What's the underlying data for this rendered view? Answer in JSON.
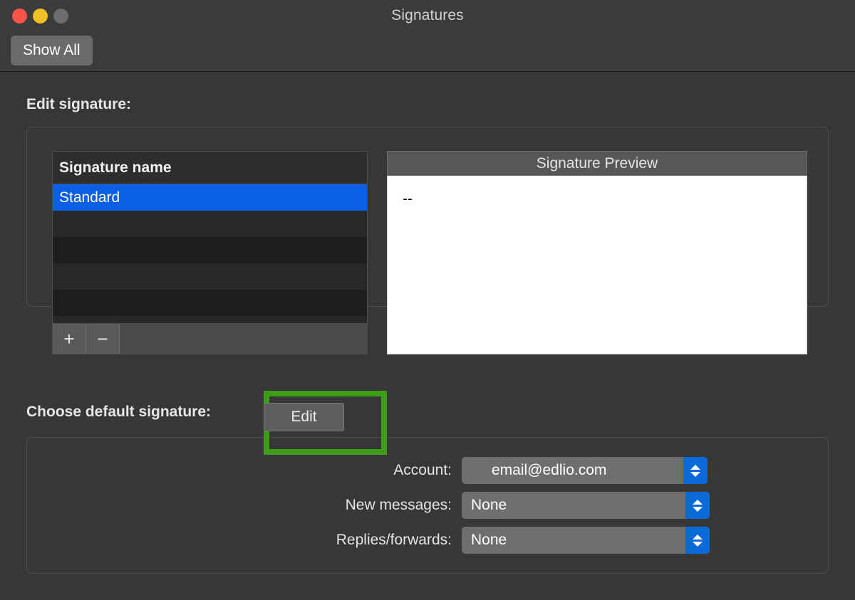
{
  "window": {
    "title": "Signatures",
    "traffic_lights": [
      {
        "name": "close-button",
        "color": "#fb544b"
      },
      {
        "name": "minimize-button",
        "color": "#f0c025"
      },
      {
        "name": "zoom-button",
        "color": "#6d6d6d"
      }
    ]
  },
  "toolbar": {
    "show_all_label": "Show All"
  },
  "edit_signature": {
    "heading": "Edit signature:",
    "list": {
      "column_header": "Signature name",
      "rows": [
        {
          "label": "Standard",
          "selected": true
        },
        {
          "label": "",
          "selected": false
        },
        {
          "label": "",
          "selected": false
        },
        {
          "label": "",
          "selected": false
        },
        {
          "label": "",
          "selected": false
        },
        {
          "label": "",
          "selected": false
        }
      ]
    },
    "list_toolbar": {
      "add_label": "+",
      "remove_label": "−",
      "edit_label": "Edit"
    },
    "preview": {
      "header": "Signature Preview",
      "body": "--"
    },
    "highlight_color": "#3e9c1a"
  },
  "default_signature": {
    "heading": "Choose default signature:",
    "rows": [
      {
        "label": "Account:",
        "value": "email@edlio.com"
      },
      {
        "label": "New messages:",
        "value": "None"
      },
      {
        "label": "Replies/forwards:",
        "value": "None"
      }
    ]
  }
}
